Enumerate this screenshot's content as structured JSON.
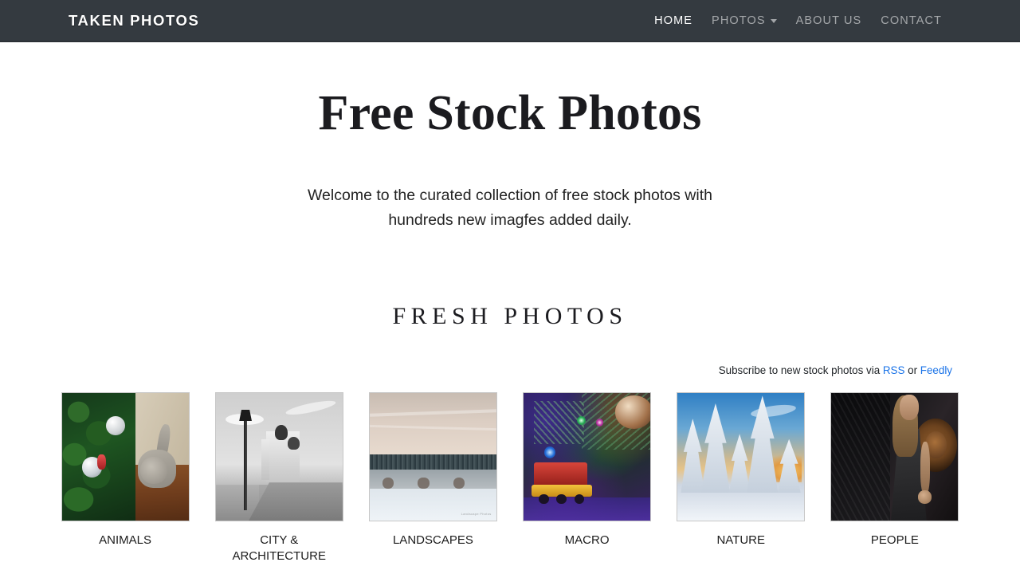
{
  "navbar": {
    "brand": "TAKEN PHOTOS",
    "links": [
      {
        "label": "HOME",
        "active": true,
        "caret": false
      },
      {
        "label": "PHOTOS",
        "active": false,
        "caret": true
      },
      {
        "label": "ABOUT US",
        "active": false,
        "caret": false
      },
      {
        "label": "CONTACT",
        "active": false,
        "caret": false
      }
    ],
    "background_color": "#343a40",
    "active_color": "#ffffff",
    "muted_color": "rgba(255,255,255,0.55)"
  },
  "hero": {
    "title": "Free Stock Photos",
    "subtitle_line1": "Welcome to the curated collection of free stock photos with",
    "subtitle_line2": "hundreds new imagfes added daily."
  },
  "section": {
    "title": "FRESH PHOTOS"
  },
  "subscribe": {
    "prefix": "Subscribe to new stock photos via ",
    "rss_label": "RSS",
    "separator": " or ",
    "feedly_label": "Feedly",
    "link_color": "#1a73e8"
  },
  "categories": [
    {
      "caption": "ANIMALS",
      "art": "t-animals"
    },
    {
      "caption": "CITY & ARCHITECTURE",
      "art": "t-city"
    },
    {
      "caption": "LANDSCAPES",
      "art": "t-land"
    },
    {
      "caption": "MACRO",
      "art": "t-macro"
    },
    {
      "caption": "NATURE",
      "art": "t-nature"
    },
    {
      "caption": "PEOPLE",
      "art": "t-people"
    }
  ],
  "watermark": "Landscape Photos"
}
